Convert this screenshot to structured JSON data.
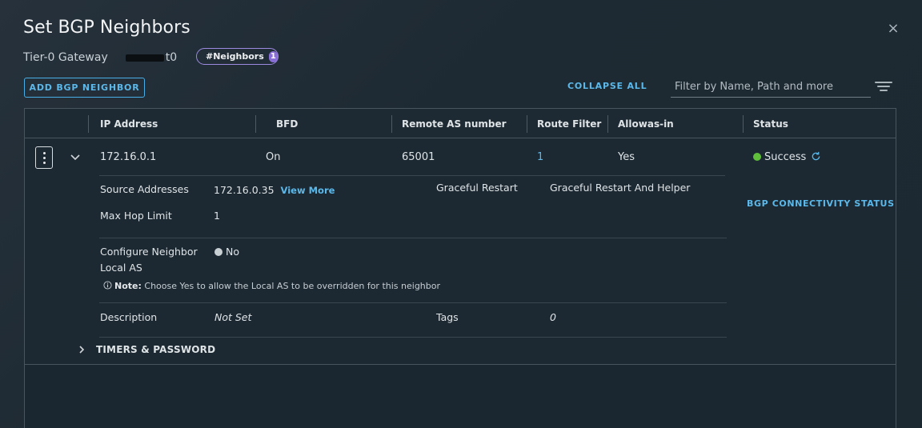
{
  "dialog": {
    "title": "Set BGP Neighbors",
    "close_label": "×"
  },
  "gateway": {
    "label": "Tier-0 Gateway",
    "name_suffix": "t0"
  },
  "badge": {
    "label": "#Neighbors",
    "count": "1"
  },
  "toolbar": {
    "add_label": "ADD BGP NEIGHBOR",
    "collapse_label": "COLLAPSE ALL",
    "filter_placeholder": "Filter by Name, Path and more"
  },
  "table": {
    "columns": [
      "IP Address",
      "BFD",
      "Remote AS number",
      "Route Filter",
      "Allowas-in",
      "Status"
    ],
    "row": {
      "ip_address": "172.16.0.1",
      "bfd": "On",
      "remote_as": "65001",
      "route_filter": "1",
      "allowas_in": "Yes",
      "status": "Success"
    }
  },
  "details": {
    "source_addresses_label": "Source Addresses",
    "source_addresses_value": "172.16.0.35",
    "view_more": "View More",
    "graceful_restart_label": "Graceful Restart",
    "graceful_restart_value": "Graceful Restart And Helper",
    "max_hop_label": "Max Hop Limit",
    "max_hop_value": "1",
    "bgp_connectivity": "BGP CONNECTIVITY STATUS",
    "configure_local_as_label_1": "Configure Neighbor",
    "configure_local_as_label_2": "Local AS",
    "configure_local_as_value": "No",
    "note_prefix": "Note:",
    "note_text": "Choose Yes to allow the Local AS to be overridden for this neighbor",
    "description_label": "Description",
    "description_value": "Not Set",
    "tags_label": "Tags",
    "tags_value": "0",
    "timers_label": "TIMERS & PASSWORD"
  },
  "colors": {
    "accent": "#5bb8ea",
    "success": "#5fbf3a",
    "badge_border": "#9b8ae0"
  }
}
